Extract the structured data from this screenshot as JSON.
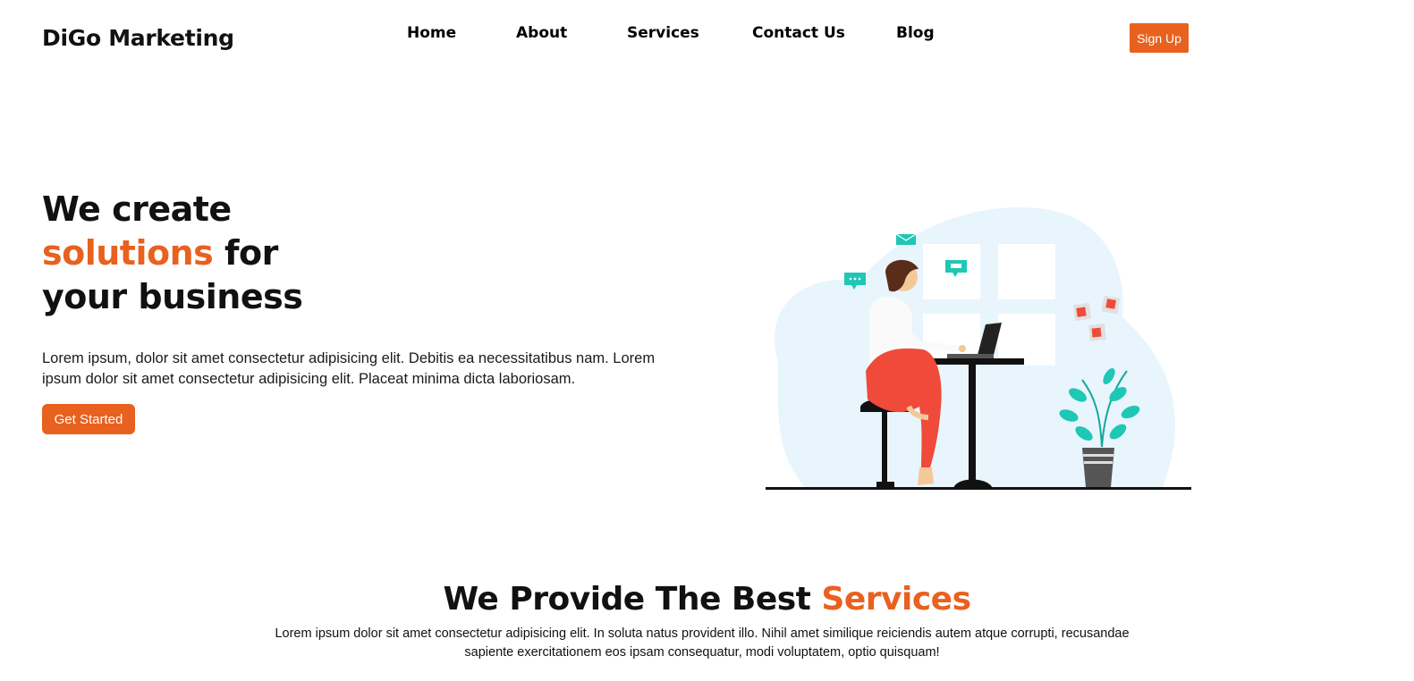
{
  "header": {
    "brand": "DiGo Marketing",
    "nav": [
      {
        "label": "Home"
      },
      {
        "label": "About"
      },
      {
        "label": "Services"
      },
      {
        "label": "Contact Us"
      },
      {
        "label": "Blog"
      }
    ],
    "signup_label": "Sign Up"
  },
  "hero": {
    "title_line1": "We create",
    "title_accent": "solutions",
    "title_line2_rest": " for",
    "title_line3": "your business",
    "description": "Lorem ipsum, dolor sit amet consectetur adipisicing elit. Debitis ea necessitatibus nam. Lorem ipsum dolor sit amet consectetur adipisicing elit. Placeat minima dicta laboriosam.",
    "cta_label": "Get Started"
  },
  "services": {
    "title_prefix": "We Provide The Best ",
    "title_accent": "Services",
    "description": "Lorem ipsum dolor sit amet consectetur adipisicing elit. In soluta natus provident illo. Nihil amet similique reiciendis autem atque corrupti, recusandae sapiente exercitationem eos ipsam consequatur, modi voluptatem, optio quisquam!"
  },
  "colors": {
    "accent": "#e8611f",
    "illustration_blob": "#e8f5fd",
    "illustration_teal": "#1fc7b5",
    "illustration_red": "#f04a3a"
  },
  "icons": [
    "mail-icon",
    "chat-bubble-icon",
    "sticky-note-icon",
    "plant-icon",
    "laptop-icon"
  ]
}
